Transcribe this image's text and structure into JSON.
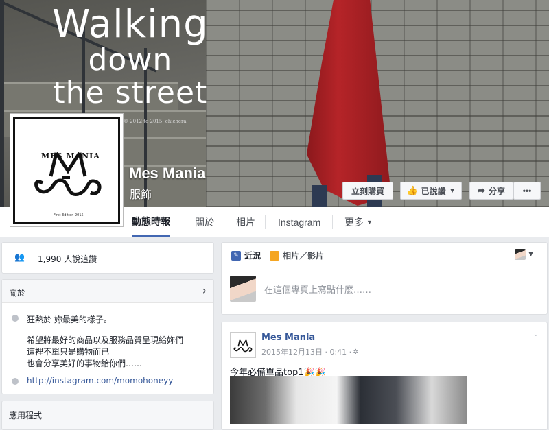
{
  "cover": {
    "title_line1": "Walking",
    "title_line2": "down",
    "title_line3": "the street",
    "credit": "© 2012 to 2015, chichera"
  },
  "profile": {
    "logo_text": "MES MANIA",
    "edition": "First Edition 2015",
    "name": "Mes Mania",
    "category": "服飾"
  },
  "actions": {
    "buy": "立刻購買",
    "liked": "已說讚",
    "share": "分享",
    "more": "•••"
  },
  "nav": {
    "timeline": "動態時報",
    "about": "關於",
    "photos": "相片",
    "instagram": "Instagram",
    "more": "更多"
  },
  "sidebar": {
    "likes": "1,990 人說這讚",
    "about_header": "關於",
    "tagline": "狂熱於 妳最美的樣子。",
    "desc_line1": "希望將最好的商品以及服務品質呈現給妳們",
    "desc_line2": "這裡不單只是購物而已",
    "desc_line3": "也會分享美好的事物給你們……",
    "link": "http://instagram.com/momohoneyy",
    "apps_header": "應用程式"
  },
  "composer": {
    "status_tab": "近況",
    "photo_tab": "相片／影片",
    "placeholder": "在這個專頁上寫點什麼……"
  },
  "post": {
    "author": "Mes Mania",
    "meta": "2015年12月13日 · 0:41 · ",
    "text": "今年必備單品top1🎉🎉"
  },
  "colors": {
    "accent": "#4267b2",
    "page_bg": "#e9ebee",
    "link": "#365899"
  }
}
